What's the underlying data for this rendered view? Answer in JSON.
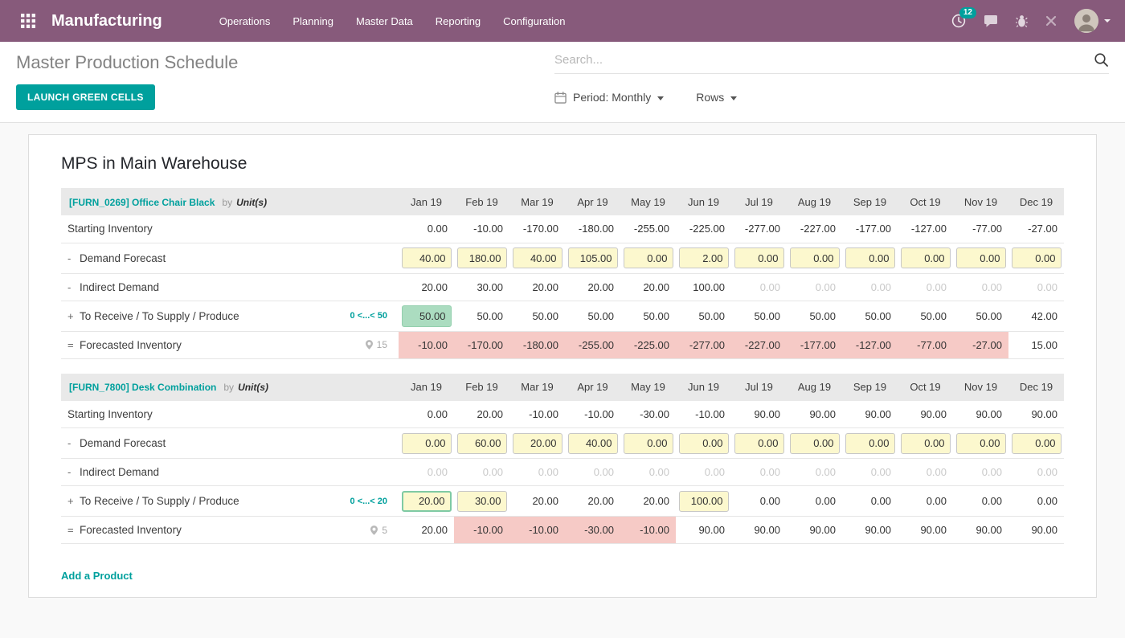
{
  "nav": {
    "app_title": "Manufacturing",
    "menus": [
      "Operations",
      "Planning",
      "Master Data",
      "Reporting",
      "Configuration"
    ],
    "activity_count": "12"
  },
  "control_panel": {
    "title": "Master Production Schedule",
    "search_placeholder": "Search...",
    "launch_button_label": "LAUNCH GREEN CELLS",
    "period_label": "Period: Monthly",
    "rows_label": "Rows"
  },
  "page": {
    "heading": "MPS in Main Warehouse",
    "add_product_label": "Add a Product"
  },
  "icons": {
    "apps": "grid-icon",
    "activities": "clock-icon",
    "messages": "chat-bubble-icon",
    "debug": "bug-icon",
    "close": "x-icon",
    "user_menu": "chevron-down-icon",
    "search": "magnifier-icon",
    "period": "calendar-icon",
    "forecast_location": "map-pin-icon"
  },
  "months": [
    "Jan 19",
    "Feb 19",
    "Mar 19",
    "Apr 19",
    "May 19",
    "Jun 19",
    "Jul 19",
    "Aug 19",
    "Sep 19",
    "Oct 19",
    "Nov 19",
    "Dec 19"
  ],
  "row_defs": [
    {
      "key": "starting",
      "sign": "",
      "label": "Starting Inventory"
    },
    {
      "key": "demand",
      "sign": "-",
      "label": "Demand Forecast"
    },
    {
      "key": "indirect",
      "sign": "-",
      "label": "Indirect Demand"
    },
    {
      "key": "to_receive",
      "sign": "+",
      "label": "To Receive / To Supply / Produce"
    },
    {
      "key": "forecasted",
      "sign": "=",
      "label": "Forecasted Inventory"
    }
  ],
  "products": [
    {
      "name": "[FURN_0269] Office Chair Black",
      "by_label": "by",
      "uom": "Unit(s)",
      "replenish_range": "0 <...< 50",
      "lead_indicator": "15",
      "rows": {
        "starting": {
          "values": [
            "0.00",
            "-10.00",
            "-170.00",
            "-180.00",
            "-255.00",
            "-225.00",
            "-277.00",
            "-227.00",
            "-177.00",
            "-127.00",
            "-77.00",
            "-27.00"
          ],
          "styles": [
            "p",
            "p",
            "p",
            "p",
            "p",
            "p",
            "p",
            "p",
            "p",
            "p",
            "p",
            "p"
          ]
        },
        "demand": {
          "values": [
            "40.00",
            "180.00",
            "40.00",
            "105.00",
            "0.00",
            "2.00",
            "0.00",
            "0.00",
            "0.00",
            "0.00",
            "0.00",
            "0.00"
          ],
          "styles": [
            "i",
            "i",
            "i",
            "i",
            "i",
            "i",
            "i",
            "i",
            "i",
            "i",
            "i",
            "i"
          ]
        },
        "indirect": {
          "values": [
            "20.00",
            "30.00",
            "20.00",
            "20.00",
            "20.00",
            "100.00",
            "0.00",
            "0.00",
            "0.00",
            "0.00",
            "0.00",
            "0.00"
          ],
          "styles": [
            "p",
            "p",
            "p",
            "p",
            "p",
            "p",
            "m",
            "m",
            "m",
            "m",
            "m",
            "m"
          ]
        },
        "to_receive": {
          "values": [
            "50.00",
            "50.00",
            "50.00",
            "50.00",
            "50.00",
            "50.00",
            "50.00",
            "50.00",
            "50.00",
            "50.00",
            "50.00",
            "42.00"
          ],
          "styles": [
            "g",
            "p",
            "p",
            "p",
            "p",
            "p",
            "p",
            "p",
            "p",
            "p",
            "p",
            "p"
          ]
        },
        "forecasted": {
          "values": [
            "-10.00",
            "-170.00",
            "-180.00",
            "-255.00",
            "-225.00",
            "-277.00",
            "-227.00",
            "-177.00",
            "-127.00",
            "-77.00",
            "-27.00",
            "15.00"
          ],
          "styles": [
            "r",
            "r",
            "r",
            "r",
            "r",
            "r",
            "r",
            "r",
            "r",
            "r",
            "r",
            "p"
          ]
        }
      }
    },
    {
      "name": "[FURN_7800] Desk Combination",
      "by_label": "by",
      "uom": "Unit(s)",
      "replenish_range": "0 <...< 20",
      "lead_indicator": "5",
      "rows": {
        "starting": {
          "values": [
            "0.00",
            "20.00",
            "-10.00",
            "-10.00",
            "-30.00",
            "-10.00",
            "90.00",
            "90.00",
            "90.00",
            "90.00",
            "90.00",
            "90.00"
          ],
          "styles": [
            "p",
            "p",
            "p",
            "p",
            "p",
            "p",
            "p",
            "p",
            "p",
            "p",
            "p",
            "p"
          ]
        },
        "demand": {
          "values": [
            "0.00",
            "60.00",
            "20.00",
            "40.00",
            "0.00",
            "0.00",
            "0.00",
            "0.00",
            "0.00",
            "0.00",
            "0.00",
            "0.00"
          ],
          "styles": [
            "i",
            "i",
            "i",
            "i",
            "i",
            "i",
            "i",
            "i",
            "i",
            "i",
            "i",
            "i"
          ]
        },
        "indirect": {
          "values": [
            "0.00",
            "0.00",
            "0.00",
            "0.00",
            "0.00",
            "0.00",
            "0.00",
            "0.00",
            "0.00",
            "0.00",
            "0.00",
            "0.00"
          ],
          "styles": [
            "m",
            "m",
            "m",
            "m",
            "m",
            "m",
            "m",
            "m",
            "m",
            "m",
            "m",
            "m"
          ]
        },
        "to_receive": {
          "values": [
            "20.00",
            "30.00",
            "20.00",
            "20.00",
            "20.00",
            "100.00",
            "0.00",
            "0.00",
            "0.00",
            "0.00",
            "0.00",
            "0.00"
          ],
          "styles": [
            "ig",
            "i",
            "p",
            "p",
            "p",
            "i",
            "p",
            "p",
            "p",
            "p",
            "p",
            "p"
          ]
        },
        "forecasted": {
          "values": [
            "20.00",
            "-10.00",
            "-10.00",
            "-30.00",
            "-10.00",
            "90.00",
            "90.00",
            "90.00",
            "90.00",
            "90.00",
            "90.00",
            "90.00"
          ],
          "styles": [
            "p",
            "r",
            "r",
            "r",
            "r",
            "p",
            "p",
            "p",
            "p",
            "p",
            "p",
            "p"
          ]
        }
      }
    }
  ]
}
